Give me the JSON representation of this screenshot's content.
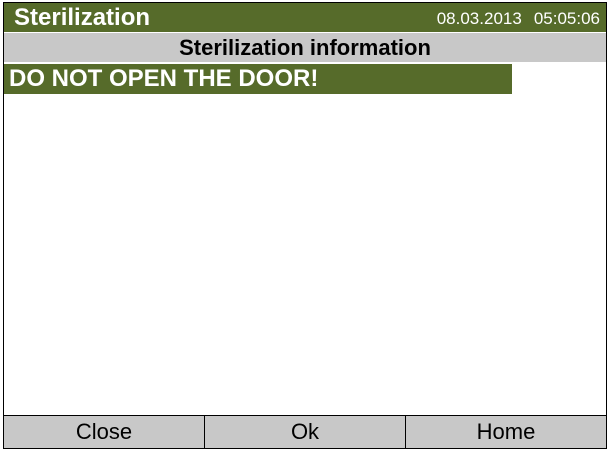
{
  "header": {
    "title": "Sterilization",
    "date": "08.03.2013",
    "time": "05:05:06"
  },
  "subheader": {
    "title": "Sterilization information"
  },
  "warning": {
    "text": "DO NOT OPEN THE DOOR!"
  },
  "footer": {
    "buttons": [
      {
        "label": "Close"
      },
      {
        "label": "Ok"
      },
      {
        "label": "Home"
      }
    ]
  },
  "colors": {
    "accent_green": "#566b2a",
    "panel_gray": "#c8c8c8"
  }
}
